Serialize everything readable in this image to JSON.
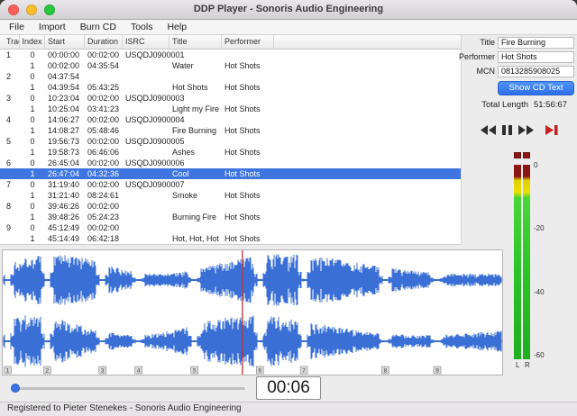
{
  "window": {
    "title": "DDP Player - Sonoris Audio Engineering",
    "status_text": "Registered to Pieter Stenekes - Sonoris Audio Engineering"
  },
  "menu_items": [
    "File",
    "Import",
    "Burn CD",
    "Tools",
    "Help"
  ],
  "table": {
    "columns": [
      "Track",
      "Index",
      "Start",
      "Duration",
      "ISRC",
      "Title",
      "Performer"
    ],
    "rows": [
      {
        "track": "1",
        "index": "0",
        "start": "00:00:00",
        "duration": "00:02:00",
        "isrc": "USQDJ0900001",
        "title": "",
        "performer": "",
        "selected": false
      },
      {
        "track": "",
        "index": "1",
        "start": "00:02:00",
        "duration": "04:35:54",
        "isrc": "",
        "title": "Water",
        "performer": "Hot Shots",
        "selected": false
      },
      {
        "track": "2",
        "index": "0",
        "start": "04:37:54",
        "duration": "",
        "isrc": "",
        "title": "",
        "performer": "",
        "selected": false
      },
      {
        "track": "",
        "index": "1",
        "start": "04:39:54",
        "duration": "05:43:25",
        "isrc": "",
        "title": "Hot Shots",
        "performer": "Hot Shots",
        "selected": false
      },
      {
        "track": "3",
        "index": "0",
        "start": "10:23:04",
        "duration": "00:02:00",
        "isrc": "USQDJ0900003",
        "title": "",
        "performer": "",
        "selected": false
      },
      {
        "track": "",
        "index": "1",
        "start": "10:25:04",
        "duration": "03:41:23",
        "isrc": "",
        "title": "Light my Fire",
        "performer": "Hot Shots",
        "selected": false
      },
      {
        "track": "4",
        "index": "0",
        "start": "14:06:27",
        "duration": "00:02:00",
        "isrc": "USQDJ0900004",
        "title": "",
        "performer": "",
        "selected": false
      },
      {
        "track": "",
        "index": "1",
        "start": "14:08:27",
        "duration": "05:48:46",
        "isrc": "",
        "title": "Fire Burning",
        "performer": "Hot Shots",
        "selected": false
      },
      {
        "track": "5",
        "index": "0",
        "start": "19:56:73",
        "duration": "00:02:00",
        "isrc": "USQDJ0900005",
        "title": "",
        "performer": "",
        "selected": false
      },
      {
        "track": "",
        "index": "1",
        "start": "19:58:73",
        "duration": "06:46:06",
        "isrc": "",
        "title": "Ashes",
        "performer": "Hot Shots",
        "selected": false
      },
      {
        "track": "6",
        "index": "0",
        "start": "26:45:04",
        "duration": "00:02:00",
        "isrc": "USQDJ0900006",
        "title": "",
        "performer": "",
        "selected": false
      },
      {
        "track": "",
        "index": "1",
        "start": "26:47:04",
        "duration": "04:32:36",
        "isrc": "",
        "title": "Cool",
        "performer": "Hot Shots",
        "selected": true
      },
      {
        "track": "7",
        "index": "0",
        "start": "31:19:40",
        "duration": "00:02:00",
        "isrc": "USQDJ0900007",
        "title": "",
        "performer": "",
        "selected": false
      },
      {
        "track": "",
        "index": "1",
        "start": "31:21:40",
        "duration": "08:24:61",
        "isrc": "",
        "title": "Smoke",
        "performer": "Hot Shots",
        "selected": false
      },
      {
        "track": "8",
        "index": "0",
        "start": "39:46:26",
        "duration": "00:02:00",
        "isrc": "",
        "title": "",
        "performer": "",
        "selected": false
      },
      {
        "track": "",
        "index": "1",
        "start": "39:48:26",
        "duration": "05:24:23",
        "isrc": "",
        "title": "Burning Fire",
        "performer": "Hot Shots",
        "selected": false
      },
      {
        "track": "9",
        "index": "0",
        "start": "45:12:49",
        "duration": "00:02:00",
        "isrc": "",
        "title": "",
        "performer": "",
        "selected": false
      },
      {
        "track": "",
        "index": "1",
        "start": "45:14:49",
        "duration": "06:42:18",
        "isrc": "",
        "title": "Hot, Hot, Hot",
        "performer": "Hot Shots",
        "selected": false
      }
    ]
  },
  "cd_text": {
    "title_label": "Title",
    "title": "Fire Burning",
    "performer_label": "Performer",
    "performer": "Hot Shots",
    "mcn_label": "MCN",
    "mcn": "0813285908025",
    "show_cd_text_button": "Show CD Text",
    "total_length_label": "Total Length",
    "total_length": "51:56:67"
  },
  "meter": {
    "scale_labels": [
      "0",
      "-20",
      "-40",
      "-60"
    ],
    "channel_labels": [
      "L",
      "R"
    ]
  },
  "waveform": {
    "track_markers": [
      {
        "num": "1",
        "pos": 0.01
      },
      {
        "num": "2",
        "pos": 0.089
      },
      {
        "num": "3",
        "pos": 0.2
      },
      {
        "num": "4",
        "pos": 0.272
      },
      {
        "num": "5",
        "pos": 0.384
      },
      {
        "num": "6",
        "pos": 0.515
      },
      {
        "num": "7",
        "pos": 0.603
      },
      {
        "num": "8",
        "pos": 0.766
      },
      {
        "num": "9",
        "pos": 0.87
      }
    ],
    "playhead_position": 0.48
  },
  "time_display": "00:06",
  "colors": {
    "accent_blue": "#3478f6",
    "selection_blue": "#3e75e0",
    "waveform_blue": "#3a6fd6",
    "playhead_red": "#c03030",
    "meter_green": "#2bc428",
    "meter_yellow": "#ecdf00",
    "meter_red": "#8c1616"
  }
}
